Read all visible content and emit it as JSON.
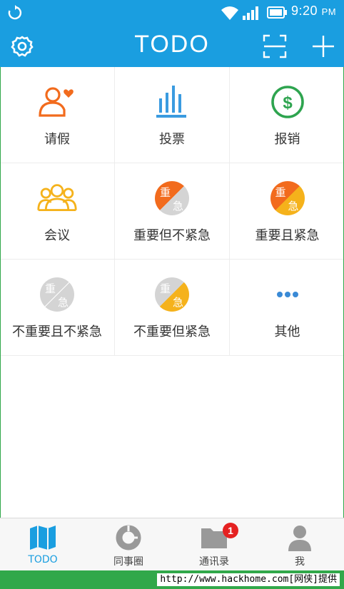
{
  "status_bar": {
    "time": "9:20",
    "ampm": "PM"
  },
  "app_bar": {
    "title": "TODO"
  },
  "grid": [
    {
      "label": "请假",
      "icon": "person-heart-icon",
      "color": "#f26b1d"
    },
    {
      "label": "投票",
      "icon": "bar-chart-icon",
      "color": "#3a9be0"
    },
    {
      "label": "报销",
      "icon": "dollar-circle-icon",
      "color": "#2ea44f"
    },
    {
      "label": "会议",
      "icon": "group-people-icon",
      "color": "#f5b21b"
    },
    {
      "label": "重要但不紧急",
      "icon": "important-not-urgent-icon",
      "top_char": "重",
      "bottom_char": "急"
    },
    {
      "label": "重要且紧急",
      "icon": "important-urgent-icon",
      "top_char": "重",
      "bottom_char": "急"
    },
    {
      "label": "不重要且不紧急",
      "icon": "not-important-not-urgent-icon",
      "top_char": "重",
      "bottom_char": "急"
    },
    {
      "label": "不重要但紧急",
      "icon": "not-important-urgent-icon",
      "top_char": "重",
      "bottom_char": "急"
    },
    {
      "label": "其他",
      "icon": "more-dots-icon",
      "color": "#3a8ad6"
    }
  ],
  "bottom_nav": [
    {
      "label": "TODO",
      "icon": "map-icon",
      "active": true
    },
    {
      "label": "同事圈",
      "icon": "pie-ring-icon"
    },
    {
      "label": "通讯录",
      "icon": "folder-icon",
      "badge": "1"
    },
    {
      "label": "我",
      "icon": "person-icon"
    }
  ],
  "footer": {
    "watermark": "http://www.hackhome.com[网侠]提供"
  },
  "colors": {
    "primary": "#1a9ee0",
    "orange": "#f26b1d",
    "yellow": "#f5b21b",
    "gray": "#d4d4d4",
    "green": "#2ea44f",
    "badge_red": "#e52222"
  }
}
